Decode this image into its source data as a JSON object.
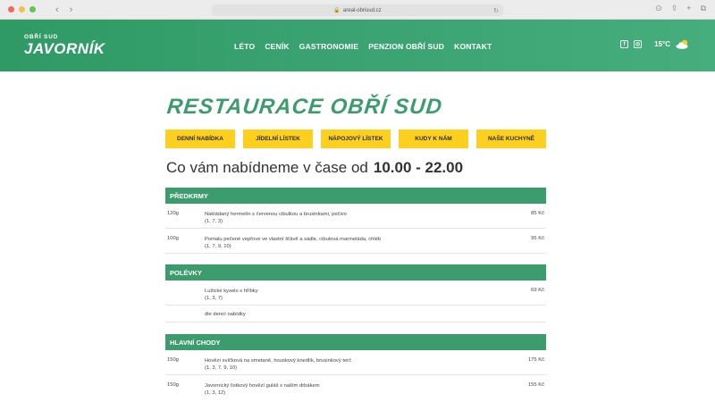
{
  "browser": {
    "url": "areal-obrisud.cz",
    "colors": {
      "red": "#ed6a5e",
      "yellow": "#f4bf4f",
      "green": "#61c554"
    }
  },
  "header": {
    "logo_small": "OBŘÍ SUD",
    "logo_big": "JAVORNÍK",
    "nav": [
      "LÉTO",
      "CENÍK",
      "GASTRONOMIE",
      "PENZION OBŘÍ SUD",
      "KONTAKT"
    ],
    "social": [
      "f",
      "◎"
    ],
    "temperature": "15°C",
    "weather_icon": "partly-cloudy-icon"
  },
  "page": {
    "title": "RESTAURACE OBŘÍ SUD",
    "tabs": [
      "DENNÍ NABÍDKA",
      "JÍDELNÍ LÍSTEK",
      "NÁPOJOVÝ LÍSTEK",
      "KUDY K NÁM",
      "NAŠE KUCHYNĚ"
    ],
    "hours_label": "Co vám nabídneme  v čase od",
    "hours_value": "10.00 - 22.00"
  },
  "menu": {
    "predkrmy": {
      "title": "PŘEDKRMY",
      "items": [
        {
          "portion": "120g",
          "name": "Nakládaný hermelín s červenou cibulkou a brusinkami, pečivo",
          "allergens": "(1, 7, 3)",
          "price": "85 Kč"
        },
        {
          "portion": "100g",
          "name": "Pomalu pečené vepřové ve vlastní šťávě a sádle, cibulová marmeláda, chléb",
          "allergens": "(1, 7, 9, 10)",
          "price": "95 Kč"
        }
      ]
    },
    "polevky": {
      "title": "POLÉVKY",
      "items": [
        {
          "portion": "",
          "name": "Lužické kyselo s hříbky",
          "allergens": "(1, 3, 7)",
          "price": "69 Kč"
        },
        {
          "portion": "",
          "name": "dle denní nabídky",
          "allergens": "",
          "price": ""
        }
      ]
    },
    "hlavni": {
      "title": "HLAVNÍ CHODY",
      "items": [
        {
          "portion": "150g",
          "name": "Hovězí svíčková na smetaně, houskový knedlík, brusinkový terč",
          "allergens": "(1, 3, 7, 9, 10)",
          "price": "175 Kč"
        },
        {
          "portion": "150g",
          "name": "Javornický lístkový hovězí guláš s naším drbákem",
          "allergens": "(1, 3, 12)",
          "price": "155 Kč"
        }
      ]
    }
  }
}
